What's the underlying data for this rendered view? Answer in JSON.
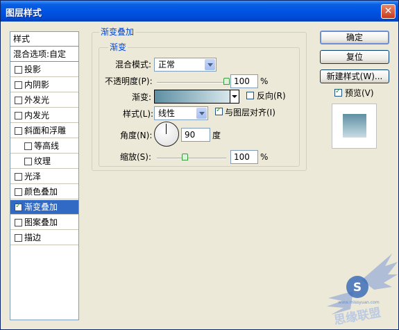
{
  "window": {
    "title": "图层样式"
  },
  "left_panel": {
    "header": "样式",
    "blend_options": "混合选项:自定",
    "items": [
      {
        "label": "投影",
        "checked": false,
        "indent": false,
        "selected": false
      },
      {
        "label": "内阴影",
        "checked": false,
        "indent": false,
        "selected": false
      },
      {
        "label": "外发光",
        "checked": false,
        "indent": false,
        "selected": false
      },
      {
        "label": "内发光",
        "checked": false,
        "indent": false,
        "selected": false
      },
      {
        "label": "斜面和浮雕",
        "checked": false,
        "indent": false,
        "selected": false
      },
      {
        "label": "等高线",
        "checked": false,
        "indent": true,
        "selected": false
      },
      {
        "label": "纹理",
        "checked": false,
        "indent": true,
        "selected": false
      },
      {
        "label": "光泽",
        "checked": false,
        "indent": false,
        "selected": false
      },
      {
        "label": "颜色叠加",
        "checked": false,
        "indent": false,
        "selected": false
      },
      {
        "label": "渐变叠加",
        "checked": true,
        "indent": false,
        "selected": true
      },
      {
        "label": "图案叠加",
        "checked": false,
        "indent": false,
        "selected": false
      },
      {
        "label": "描边",
        "checked": false,
        "indent": false,
        "selected": false
      }
    ]
  },
  "panel": {
    "outer_title": "渐变叠加",
    "inner_title": "渐变",
    "blend_mode": {
      "label": "混合模式:",
      "value": "正常"
    },
    "opacity": {
      "label": "不透明度(P):",
      "value": "100",
      "unit": "%",
      "fraction": 1.0
    },
    "gradient": {
      "label": "渐变:",
      "start_color": "#5e8fa3",
      "end_color": "#e6f1f4"
    },
    "reverse": {
      "label": "反向(R)",
      "checked": false
    },
    "style": {
      "label": "样式(L):",
      "value": "线性"
    },
    "align": {
      "label": "与图层对齐(I)",
      "checked": true
    },
    "angle": {
      "label": "角度(N):",
      "value": "90",
      "unit": "度"
    },
    "scale": {
      "label": "缩放(S):",
      "value": "100",
      "unit": "%",
      "fraction": 0.4
    }
  },
  "buttons": {
    "ok": "确定",
    "reset": "复位",
    "new_style": "新建样式(W)...",
    "preview": {
      "label": "预览(V)",
      "checked": true
    }
  },
  "colors": {
    "titlebar": "#0054e3",
    "dialog_bg": "#ece9d8",
    "selection": "#316ac5",
    "group_title": "#0046d5",
    "preview_gradient_top": "#5e8fa3",
    "preview_gradient_bottom": "#c9dde5"
  },
  "watermark": {
    "icon": "winged-s-logo",
    "text": "思缘联盟",
    "site": "www.missyuan.com"
  }
}
